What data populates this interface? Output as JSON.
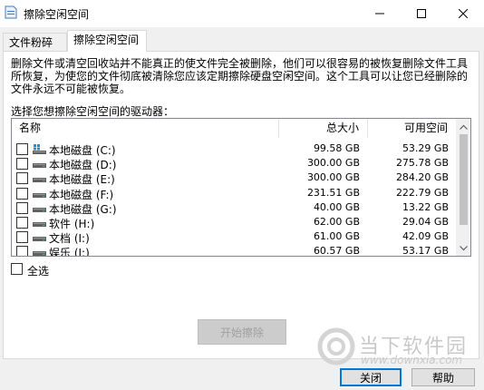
{
  "window": {
    "title": "擦除空闲空间",
    "minimize_glyph": "─",
    "maximize_glyph": "☐",
    "close_glyph": "✕"
  },
  "tabs": [
    {
      "label": "文件粉碎器",
      "active": false
    },
    {
      "label": "擦除空闲空间",
      "active": true
    }
  ],
  "description": "删除文件或清空回收站并不能真正的使文件完全被删除，他们可以很容易的被恢复删除文件工具所恢复，为使您的文件彻底被清除您应该定期擦除硬盘空闲空间。这个工具可以让您已经删除的文件永远不可能被恢复。",
  "list_label": "选择您想擦除空闲空间的驱动器：",
  "columns": {
    "name": "名称",
    "total": "总大小",
    "available": "可用空间"
  },
  "drives": [
    {
      "name": "本地磁盘 (C:)",
      "total": "99.58 GB",
      "available": "53.29 GB",
      "icon": "windows-drive-icon"
    },
    {
      "name": "本地磁盘 (D:)",
      "total": "300.00 GB",
      "available": "275.78 GB",
      "icon": "drive-icon"
    },
    {
      "name": "本地磁盘 (E:)",
      "total": "300.00 GB",
      "available": "284.20 GB",
      "icon": "drive-icon"
    },
    {
      "name": "本地磁盘 (F:)",
      "total": "231.51 GB",
      "available": "222.79 GB",
      "icon": "drive-icon"
    },
    {
      "name": "本地磁盘 (G:)",
      "total": "40.00 GB",
      "available": "13.22 GB",
      "icon": "drive-icon"
    },
    {
      "name": "软件 (H:)",
      "total": "62.00 GB",
      "available": "29.04 GB",
      "icon": "drive-icon"
    },
    {
      "name": "文档 (I:)",
      "total": "61.00 GB",
      "available": "42.09 GB",
      "icon": "drive-icon"
    },
    {
      "name": "娱乐 (J:)",
      "total": "60.57 GB",
      "available": "53.17 GB",
      "icon": "drive-icon"
    }
  ],
  "select_all_label": "全选",
  "buttons": {
    "start": "开始擦除",
    "close": "关闭",
    "help": "帮助"
  },
  "watermark": {
    "name": "当下软件园",
    "url": "www.downxia.com"
  },
  "colors": {
    "accent": "#0078d7",
    "scroll_thumb": "#c2c2c2"
  }
}
